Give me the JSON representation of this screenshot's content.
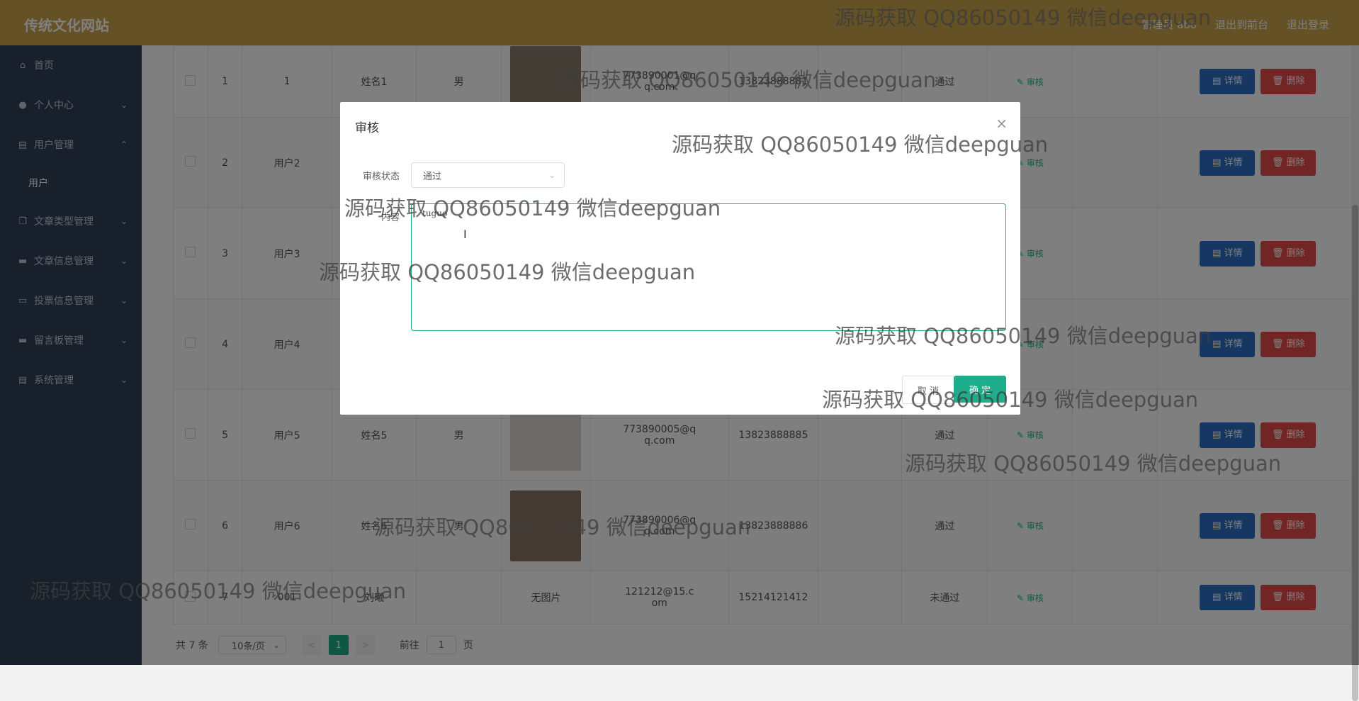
{
  "app": {
    "brand": "传统文化网站",
    "top_links": [
      "管理员 abo",
      "退出到前台",
      "退出登录"
    ]
  },
  "sidebar": {
    "items": [
      {
        "label": "首页",
        "icon": "home-icon",
        "arrow": ""
      },
      {
        "label": "个人中心",
        "icon": "user-icon",
        "arrow": "⌄"
      },
      {
        "label": "用户管理",
        "icon": "clipboard-icon",
        "arrow": "⌃"
      },
      {
        "label": "文章类型管理",
        "icon": "copy-icon",
        "arrow": "⌄"
      },
      {
        "label": "文章信息管理",
        "icon": "monitor-icon",
        "arrow": "⌄"
      },
      {
        "label": "投票信息管理",
        "icon": "card-icon",
        "arrow": "⌄"
      },
      {
        "label": "留言板管理",
        "icon": "monitor-icon",
        "arrow": "⌄"
      },
      {
        "label": "系统管理",
        "icon": "clipboard-icon",
        "arrow": "⌄"
      }
    ],
    "sub_item": "用户"
  },
  "table": {
    "rows": [
      {
        "idx": "1",
        "account": "1",
        "name": "姓名1",
        "gender": "男",
        "photo": true,
        "no_photo_text": "",
        "email": "773890001@qq.com",
        "phone": "13823888881",
        "status": "通过",
        "avatar_color": "#8a7c6e"
      },
      {
        "idx": "2",
        "account": "用户2",
        "name": "",
        "gender": "",
        "photo": false,
        "no_photo_text": "",
        "email": "",
        "phone": "",
        "status": "",
        "avatar_color": ""
      },
      {
        "idx": "3",
        "account": "用户3",
        "name": "",
        "gender": "",
        "photo": false,
        "no_photo_text": "",
        "email": "",
        "phone": "",
        "status": "",
        "avatar_color": ""
      },
      {
        "idx": "4",
        "account": "用户4",
        "name": "",
        "gender": "",
        "photo": false,
        "no_photo_text": "",
        "email": "",
        "phone": "",
        "status": "",
        "avatar_color": ""
      },
      {
        "idx": "5",
        "account": "用户5",
        "name": "姓名5",
        "gender": "男",
        "photo": true,
        "no_photo_text": "",
        "email": "773890005@qq.com",
        "phone": "13823888885",
        "status": "通过",
        "avatar_color": "#dcd4cf"
      },
      {
        "idx": "6",
        "account": "用户6",
        "name": "姓名6",
        "gender": "男",
        "photo": true,
        "no_photo_text": "",
        "email": "773890006@qq.com",
        "phone": "13823888886",
        "status": "通过",
        "avatar_color": "#8b7464"
      },
      {
        "idx": "7",
        "account": "001",
        "name": "刘曦",
        "gender": "",
        "photo": false,
        "no_photo_text": "无图片",
        "email": "121212@15.com",
        "phone": "15214121412",
        "status": "未通过",
        "avatar_color": ""
      }
    ],
    "audit_label": "✎ 审核",
    "detail_label": "▤ 详情",
    "delete_label": "🗑 删除"
  },
  "pager": {
    "total": "共 7 条",
    "page_size": "10条/页",
    "prev": "<",
    "current": "1",
    "next": ">",
    "goto_prefix": "前往",
    "goto_value": "1",
    "goto_suffix": "页"
  },
  "dialog": {
    "title": "审核",
    "close": "×",
    "status_label": "审核状态",
    "status_value": "通过",
    "content_label": "内容",
    "content_value": "tuguo",
    "cancel": "取 消",
    "confirm": "确 定"
  },
  "watermark": "源码获取 QQ86050149 微信deepguan",
  "colors": {
    "topbar": "#c8a24a",
    "sidebar": "#304156",
    "accent": "#1eae8b",
    "detail": "#2e6fc6",
    "delete": "#e24a4a"
  }
}
